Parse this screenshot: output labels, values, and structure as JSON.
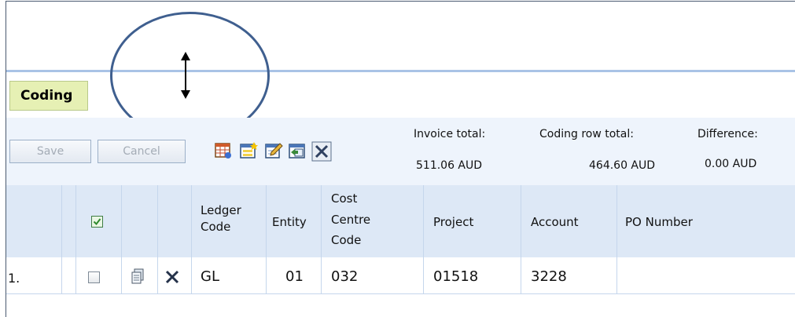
{
  "section": {
    "tab_label": "Coding"
  },
  "toolbar": {
    "save_label": "Save",
    "cancel_label": "Cancel",
    "icons": [
      "row-add-icon",
      "row-insert-icon",
      "edit-icon",
      "import-icon",
      "delete-all-icon"
    ]
  },
  "totals": {
    "invoice_label": "Invoice total:",
    "invoice_value": "511.06 AUD",
    "coding_label": "Coding row total:",
    "coding_value": "464.60 AUD",
    "difference_label": "Difference:",
    "difference_value": "0.00 AUD"
  },
  "grid": {
    "headers": {
      "ledger_line1": "Ledger",
      "ledger_line2": "Code",
      "entity": "Entity",
      "cost_line1": "Cost",
      "cost_line2": "Centre",
      "cost_line3": "Code",
      "project": "Project",
      "account": "Account",
      "po_number": "PO Number"
    },
    "header_checkbox_checked": true,
    "rows": [
      {
        "index": "1.",
        "checked": false,
        "ledger": "GL",
        "entity": "01",
        "cost_centre": "032",
        "project": "01518",
        "account": "3228",
        "po_number": ""
      }
    ]
  },
  "colors": {
    "tab_bg": "#e6f0b4",
    "toolbar_bg": "#eef4fc",
    "header_bg": "#dde8f6",
    "accent_line": "#a9c3e6",
    "annotation_oval": "#3f5f8f"
  }
}
